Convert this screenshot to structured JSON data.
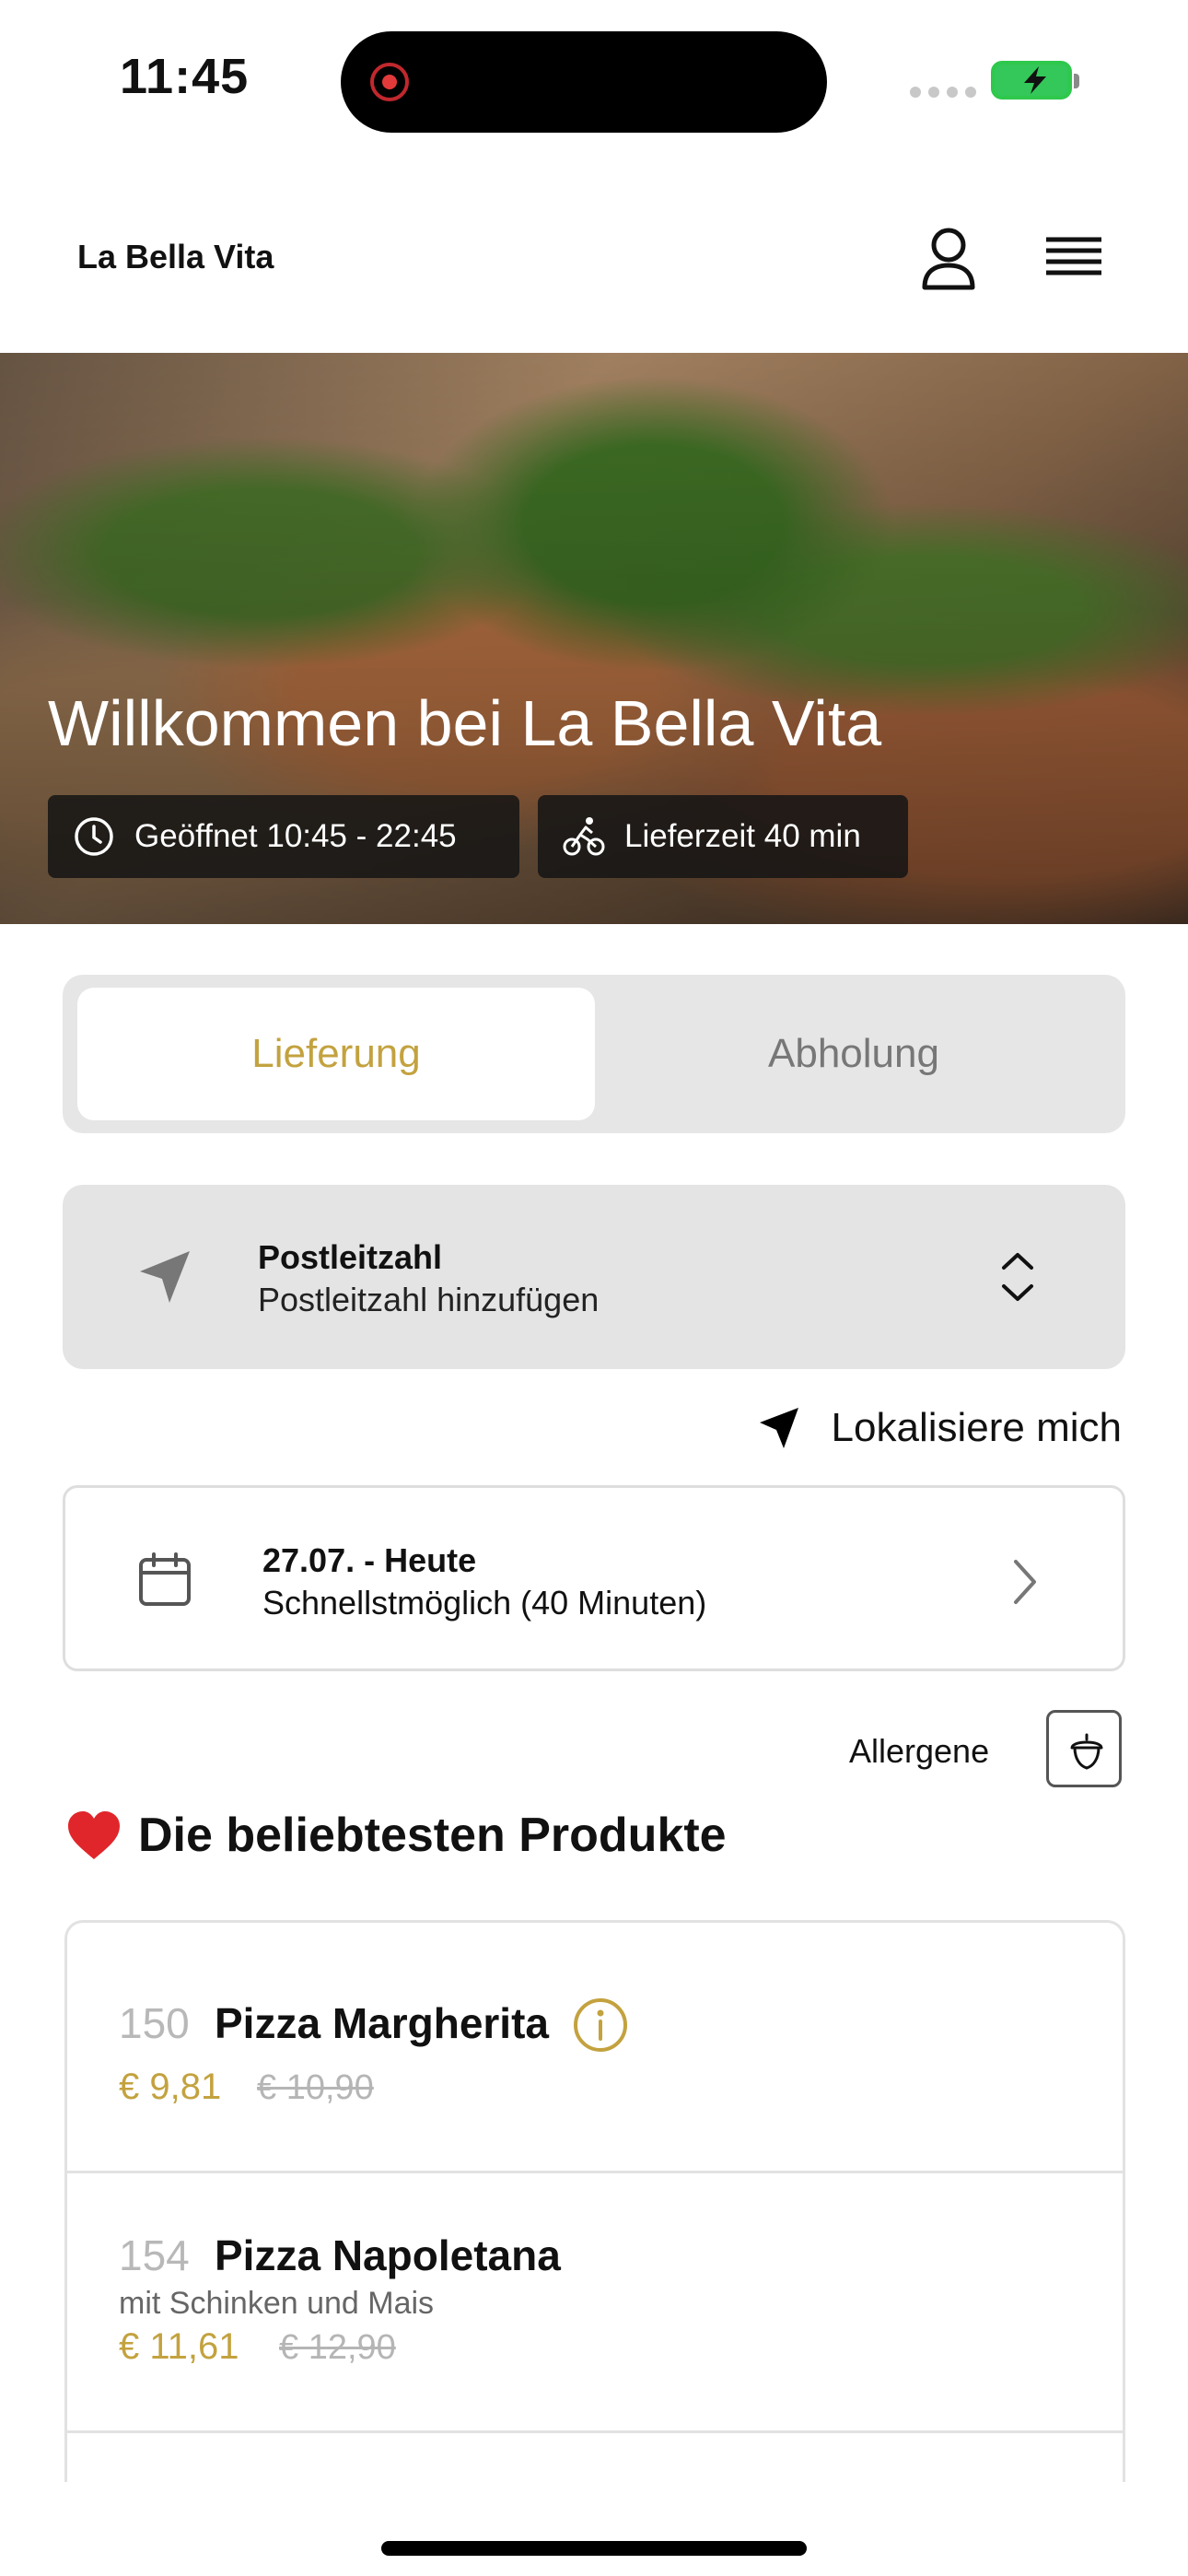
{
  "status_bar": {
    "time": "11:45"
  },
  "header": {
    "brand": "La Bella Vita"
  },
  "hero": {
    "title": "Willkommen bei La Bella Vita",
    "hours": "Geöffnet 10:45 - 22:45",
    "delivery_time": "Lieferzeit 40 min"
  },
  "mode_tabs": [
    {
      "label": "Lieferung",
      "active": true
    },
    {
      "label": "Abholung",
      "active": false
    }
  ],
  "postal": {
    "label": "Postleitzahl",
    "placeholder": "Postleitzahl hinzufügen"
  },
  "locate": {
    "label": "Lokalisiere mich"
  },
  "date": {
    "title": "27.07. - Heute",
    "subtitle": "Schnellstmöglich (40 Minuten)"
  },
  "allergens": {
    "label": "Allergene"
  },
  "section": {
    "title": "Die beliebtesten Produkte"
  },
  "products": [
    {
      "number": "150",
      "name": "Pizza Margherita",
      "description": "",
      "price": "€ 9,81",
      "old_price": "€ 10,90"
    },
    {
      "number": "154",
      "name": "Pizza Napoletana",
      "description": "mit Schinken und Mais",
      "price": "€ 11,61",
      "old_price": "€ 12,90"
    }
  ],
  "colors": {
    "accent": "#c3a23f",
    "battery": "#34c759",
    "record": "#e23a3a"
  },
  "icons": [
    "user-icon",
    "menu-icon",
    "clock-icon",
    "bike-icon",
    "location-arrow-icon",
    "chevron-up-down-icon",
    "calendar-icon",
    "chevron-right-icon",
    "acorn-icon",
    "heart-icon",
    "info-icon"
  ]
}
